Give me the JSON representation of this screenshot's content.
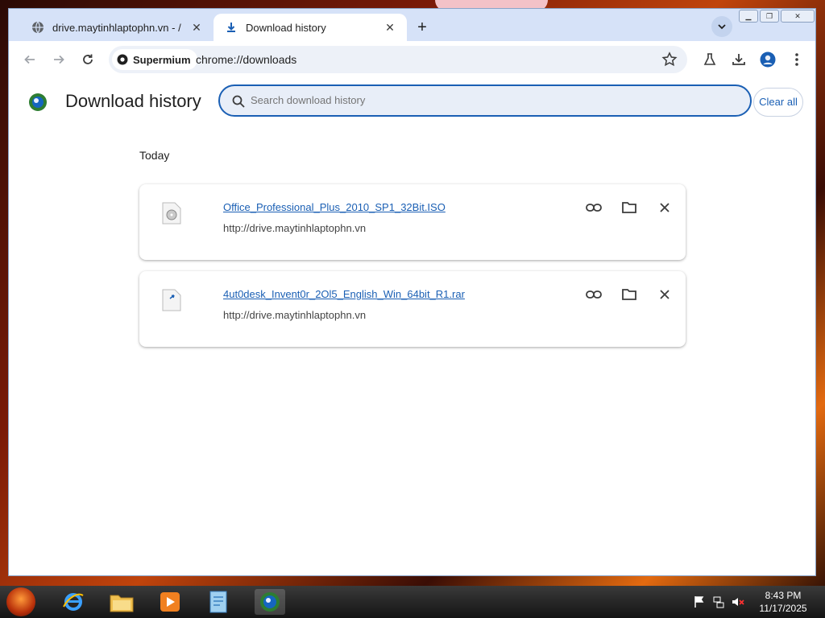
{
  "tabs": [
    {
      "title": "drive.maytinhlaptophn.vn - /",
      "icon": "globe-icon"
    },
    {
      "title": "Download history",
      "icon": "download-icon"
    }
  ],
  "toolbar": {
    "site_chip": "Supermium",
    "url": "chrome://downloads"
  },
  "page": {
    "title": "Download history",
    "search_placeholder": "Search download history",
    "clear_all": "Clear all",
    "section": "Today"
  },
  "downloads": [
    {
      "name": "Office_Professional_Plus_2010_SP1_32Bit.ISO",
      "source": "http://drive.maytinhlaptophn.vn"
    },
    {
      "name": "4ut0desk_Invent0r_2Ol5_English_Win_64bit_R1.rar",
      "source": "http://drive.maytinhlaptophn.vn"
    }
  ],
  "clock": {
    "time": "8:43 PM",
    "date": "11/17/2025"
  },
  "colors": {
    "accent": "#1a5fb4",
    "tabstrip": "#d6e2f8",
    "omnibox": "#edf1f8"
  }
}
